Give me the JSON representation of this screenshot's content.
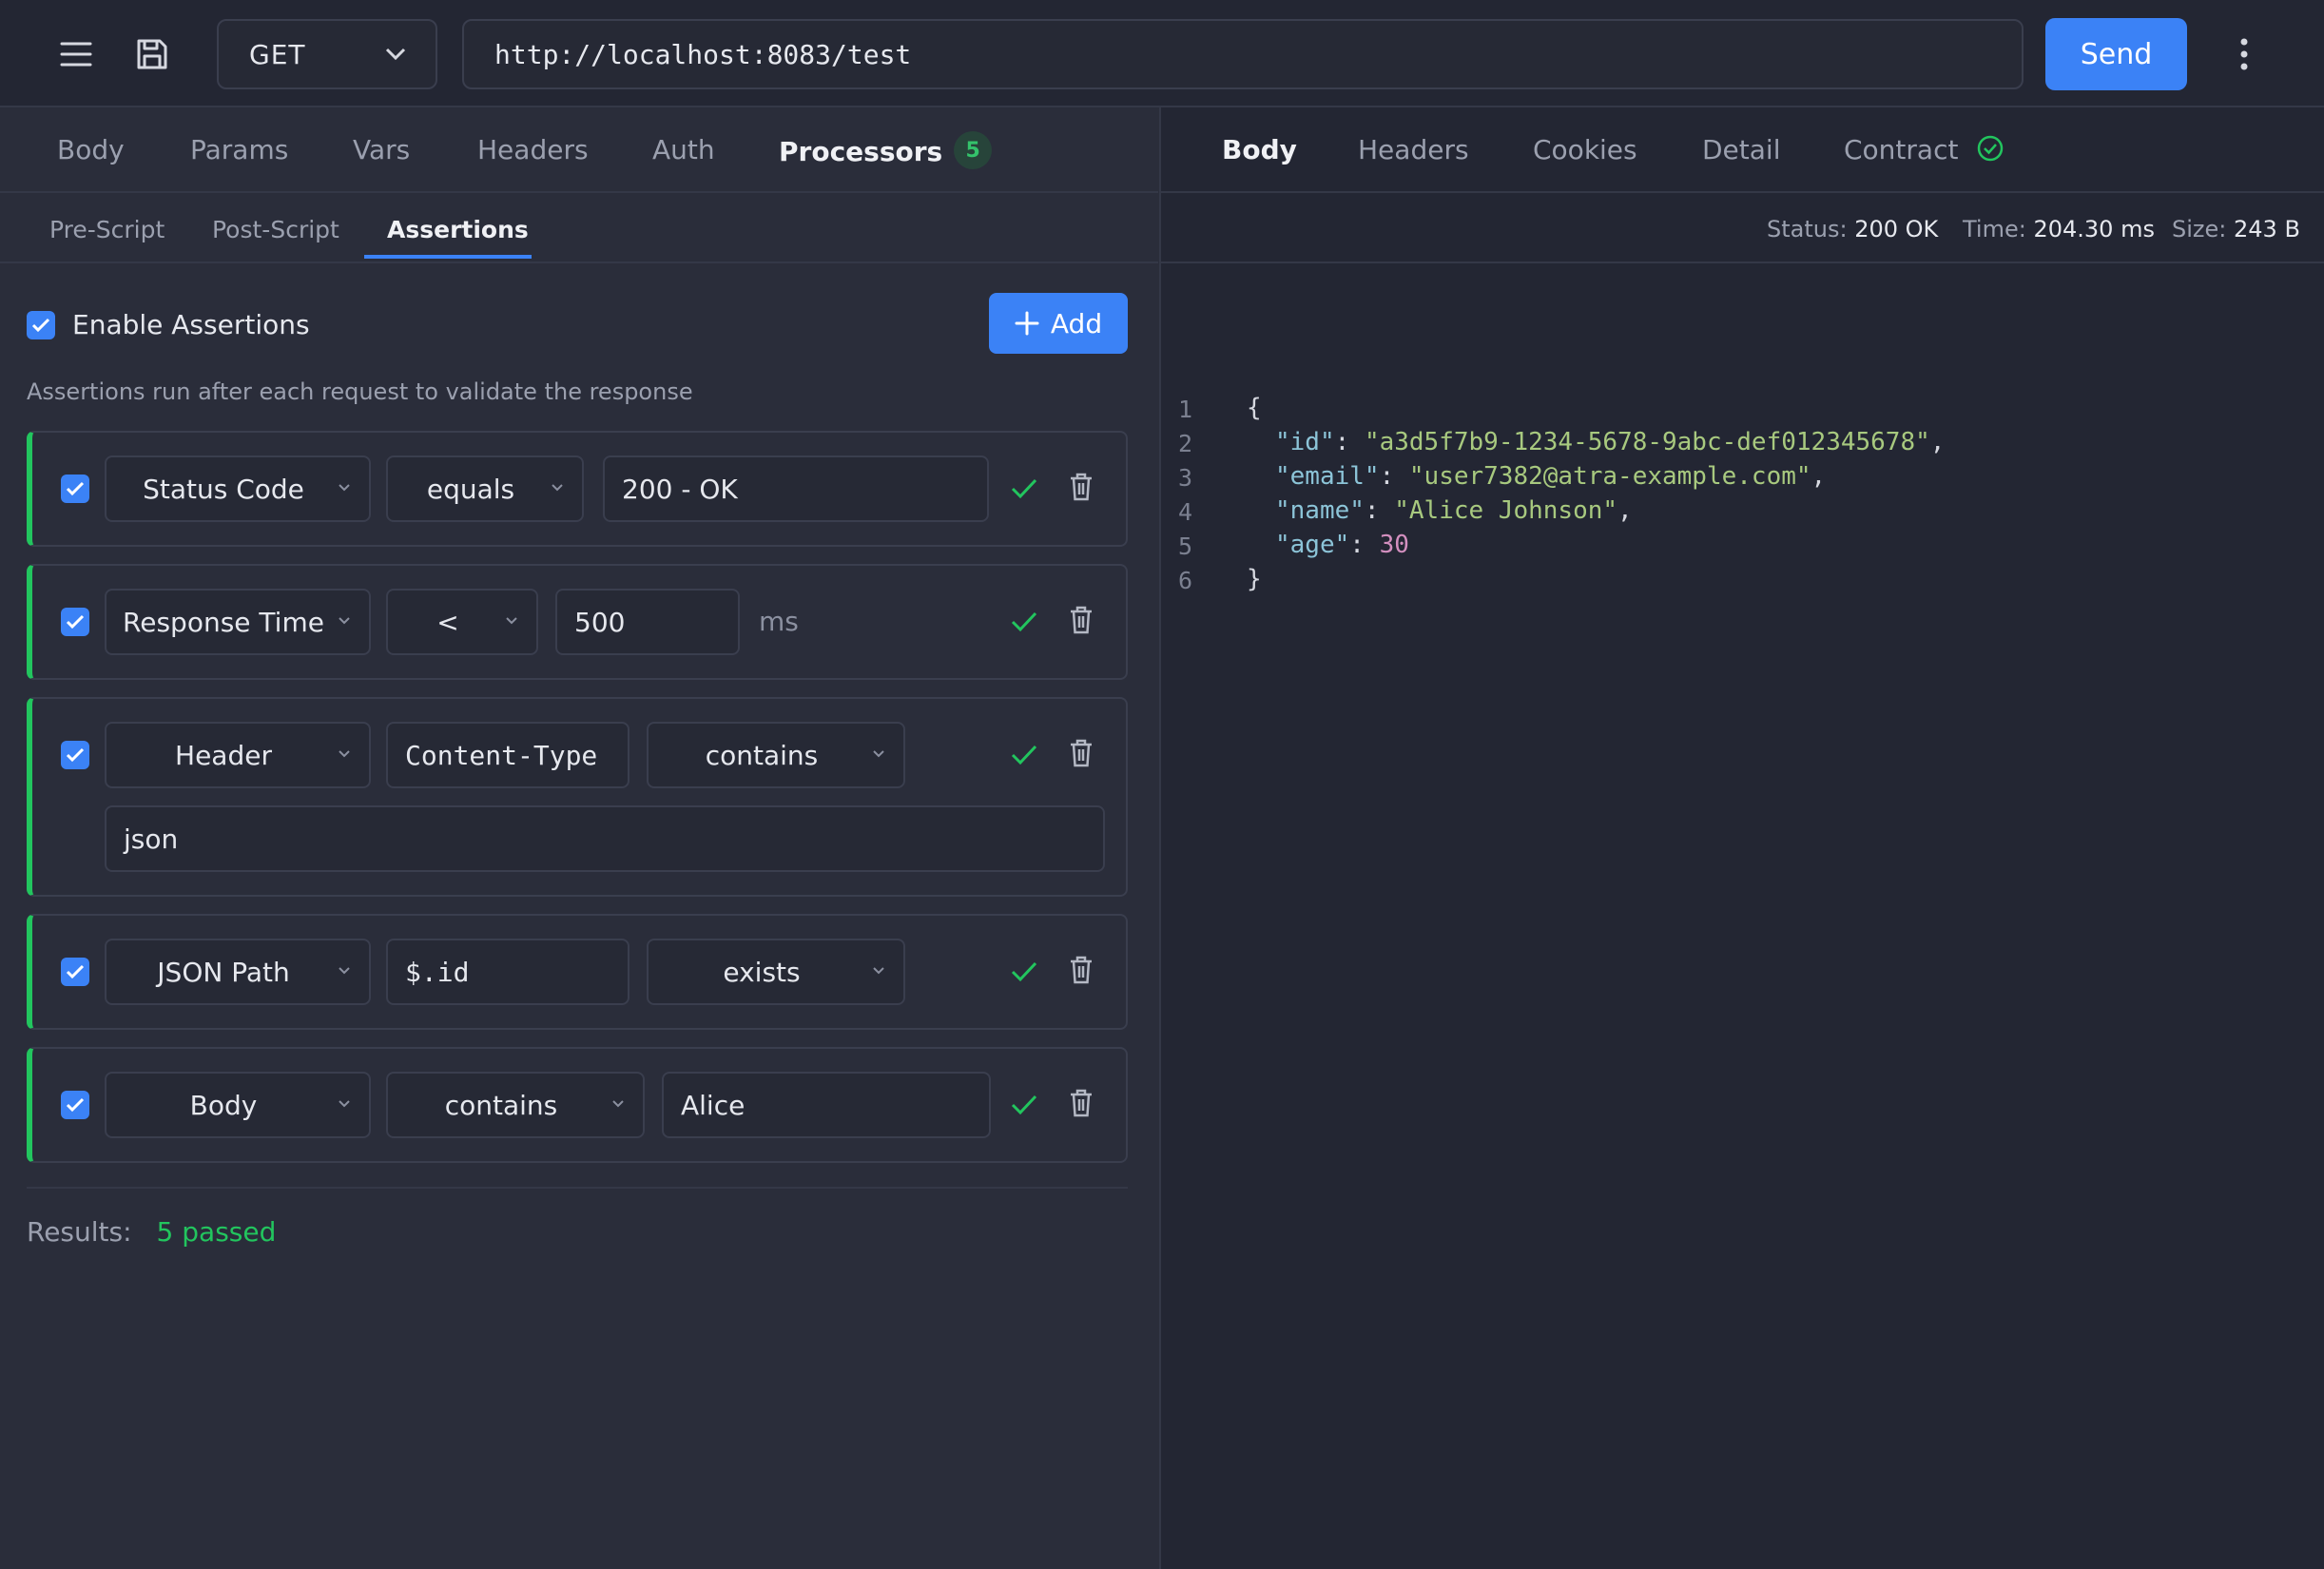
{
  "topbar": {
    "method": "GET",
    "url": "http://localhost:8083/test",
    "send_label": "Send"
  },
  "request_tabs": [
    {
      "label": "Body"
    },
    {
      "label": "Params"
    },
    {
      "label": "Vars"
    },
    {
      "label": "Headers"
    },
    {
      "label": "Auth"
    },
    {
      "label": "Processors",
      "badge": "5",
      "active": true
    }
  ],
  "processor_tabs": [
    {
      "label": "Pre-Script"
    },
    {
      "label": "Post-Script"
    },
    {
      "label": "Assertions",
      "active": true
    }
  ],
  "assertions": {
    "enable_label": "Enable Assertions",
    "add_label": "Add",
    "hint": "Assertions run after each request to validate the response",
    "rows": [
      {
        "type": "Status Code",
        "operator": "equals",
        "value": "200 - OK"
      },
      {
        "type": "Response Time",
        "operator": "<",
        "value": "500",
        "unit": "ms"
      },
      {
        "type": "Header",
        "target": "Content-Type",
        "operator": "contains",
        "value": "json"
      },
      {
        "type": "JSON Path",
        "target": "$.id",
        "operator": "exists"
      },
      {
        "type": "Body",
        "operator": "contains",
        "value": "Alice"
      }
    ],
    "results_label": "Results:",
    "results_value": "5 passed"
  },
  "response_tabs": [
    {
      "label": "Body",
      "active": true
    },
    {
      "label": "Headers"
    },
    {
      "label": "Cookies"
    },
    {
      "label": "Detail"
    },
    {
      "label": "Contract"
    }
  ],
  "response_meta": {
    "status_label": "Status:",
    "status_value": "200 OK",
    "time_label": "Time:",
    "time_value": "204.30 ms",
    "size_label": "Size:",
    "size_value": "243 B"
  },
  "response_body": {
    "open": "{",
    "close": "}",
    "id_key": "\"id\"",
    "id_value": "\"a3d5f7b9-1234-5678-9abc-def012345678\"",
    "email_key": "\"email\"",
    "email_value": "\"user7382@atra-example.com\"",
    "name_key": "\"name\"",
    "name_value": "\"Alice Johnson\"",
    "age_key": "\"age\"",
    "age_value": "30",
    "line_numbers": [
      "1",
      "2",
      "3",
      "4",
      "5",
      "6"
    ]
  },
  "colors": {
    "accent": "#3b82f6",
    "success": "#22c55e",
    "background": "#2a2d3a"
  },
  "icons": [
    "menu-icon",
    "save-icon",
    "chevron-down-icon",
    "more-vertical-icon",
    "plus-icon",
    "check-icon",
    "trash-icon",
    "check-circle-icon"
  ]
}
